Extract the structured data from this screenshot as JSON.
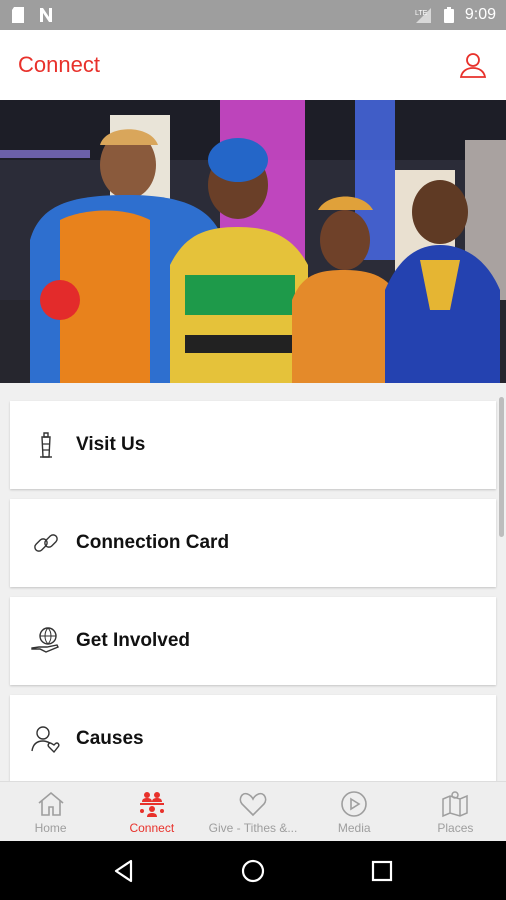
{
  "status_bar": {
    "time": "9:09",
    "network": "LTE"
  },
  "app_bar": {
    "title": "Connect",
    "profile_icon": "person-icon",
    "accent_color": "#e8312b"
  },
  "hero": {
    "description_icon": "group-photo"
  },
  "menu": {
    "items": [
      {
        "label": "Visit Us",
        "icon": "lighthouse-icon"
      },
      {
        "label": "Connection Card",
        "icon": "link-icon"
      },
      {
        "label": "Get Involved",
        "icon": "globe-hand-icon"
      },
      {
        "label": "Causes",
        "icon": "person-heart-icon"
      }
    ]
  },
  "bottom_nav": {
    "active": "Connect",
    "items": [
      {
        "label": "Home",
        "icon": "home-icon"
      },
      {
        "label": "Connect",
        "icon": "people-connect-icon"
      },
      {
        "label": "Give - Tithes &...",
        "icon": "heart-icon"
      },
      {
        "label": "Media",
        "icon": "play-circle-icon"
      },
      {
        "label": "Places",
        "icon": "map-icon"
      }
    ]
  }
}
